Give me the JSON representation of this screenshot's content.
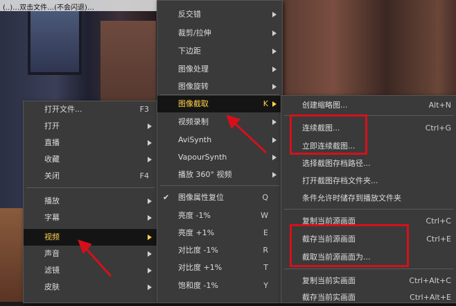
{
  "background": {
    "top_strip_text": "(..)…双击文件…(不会闪退)…"
  },
  "menu_main": {
    "items": [
      {
        "label": "打开文件...",
        "shortcut": "F3"
      },
      {
        "label": "打开",
        "submenu": true
      },
      {
        "label": "直播",
        "submenu": true
      },
      {
        "label": "收藏",
        "submenu": true
      },
      {
        "label": "关闭",
        "shortcut": "F4"
      },
      {
        "label": "播放",
        "submenu": true
      },
      {
        "label": "字幕",
        "submenu": true
      },
      {
        "label": "视频",
        "submenu": true,
        "highlighted": true
      },
      {
        "label": "声音",
        "submenu": true
      },
      {
        "label": "滤镜",
        "submenu": true
      },
      {
        "label": "皮肤",
        "submenu": true
      }
    ]
  },
  "menu_video": {
    "items": [
      {
        "label": "反交错",
        "submenu": true
      },
      {
        "label": "裁剪/拉伸",
        "submenu": true
      },
      {
        "label": "下边距",
        "submenu": true
      },
      {
        "label": "图像处理",
        "submenu": true
      },
      {
        "label": "图像旋转",
        "submenu": true
      },
      {
        "label": "图像截取",
        "shortcut": "K",
        "submenu": true,
        "highlighted": true
      },
      {
        "label": "视频录制",
        "submenu": true
      },
      {
        "label": "AviSynth",
        "submenu": true
      },
      {
        "label": "VapourSynth",
        "submenu": true
      },
      {
        "label": "播放 360° 视频",
        "submenu": true
      },
      {
        "label": "图像属性复位",
        "shortcut": "Q",
        "checked": true
      },
      {
        "label": "亮度 -1%",
        "shortcut": "W"
      },
      {
        "label": "亮度 +1%",
        "shortcut": "E"
      },
      {
        "label": "对比度 -1%",
        "shortcut": "R"
      },
      {
        "label": "对比度 +1%",
        "shortcut": "T"
      },
      {
        "label": "饱和度 -1%",
        "shortcut": "Y"
      }
    ]
  },
  "menu_capture": {
    "items": [
      {
        "label": "创建缩略图...",
        "shortcut": "Alt+N"
      },
      {
        "label": "连续截图...",
        "shortcut": "Ctrl+G"
      },
      {
        "label": "立即连续截图..."
      },
      {
        "label": "选择截图存档路径..."
      },
      {
        "label": "打开截图存档文件夹..."
      },
      {
        "label": "条件允许时储存到播放文件夹"
      },
      {
        "label": "复制当前源画面",
        "shortcut": "Ctrl+C"
      },
      {
        "label": "截存当前源画面",
        "shortcut": "Ctrl+E"
      },
      {
        "label": "截取当前源画面为..."
      },
      {
        "label": "复制当前实画面",
        "shortcut": "Ctrl+Alt+C"
      },
      {
        "label": "截存当前实画面",
        "shortcut": "Ctrl+Alt+E"
      }
    ]
  },
  "colors": {
    "highlight_text": "#ffd24a",
    "annotation_red": "#d6101b",
    "menu_bg": "#3a3a3a"
  }
}
